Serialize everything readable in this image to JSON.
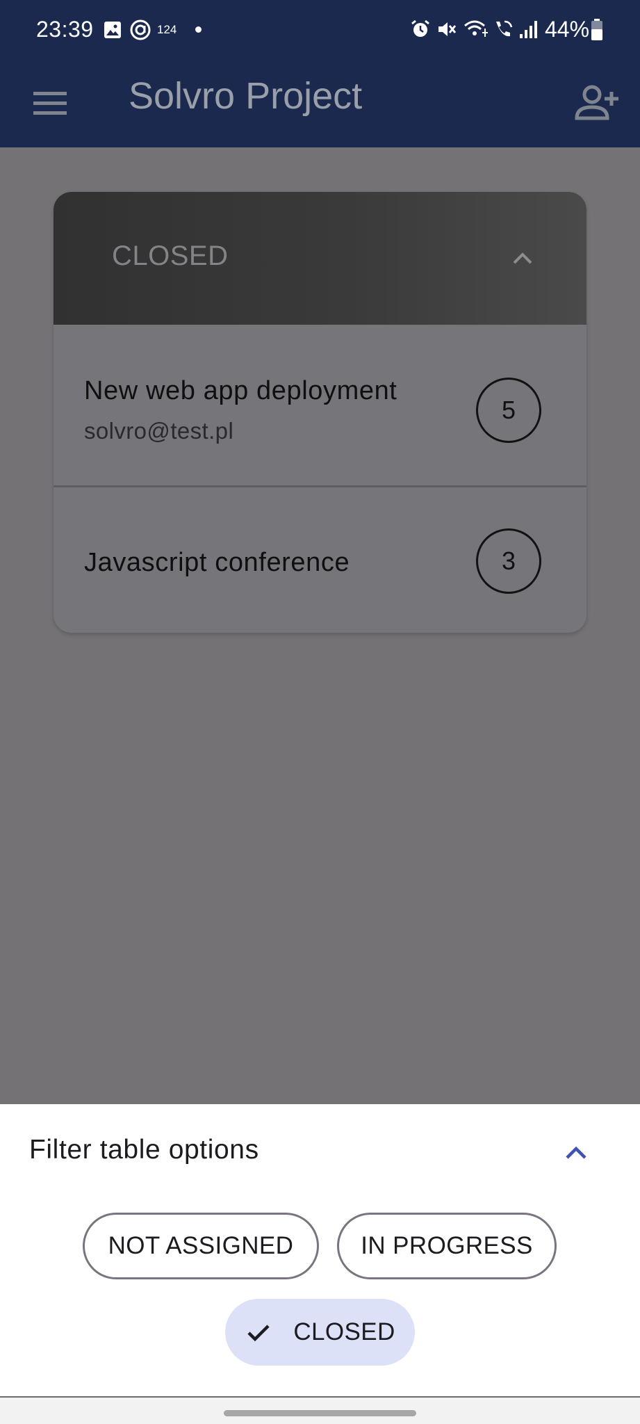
{
  "status_bar": {
    "time": "23:39",
    "notification_count": "124",
    "battery": "44%",
    "icons": [
      "gallery-icon",
      "at-sign-icon",
      "dot-icon",
      "alarm-icon",
      "mute-icon",
      "wifi-calling-icon",
      "call-icon",
      "signal-icon",
      "battery-icon"
    ]
  },
  "app_bar": {
    "title": "Solvro Project",
    "menu_icon": "menu-icon",
    "action_icon": "add-person-icon",
    "background_color": "#1b294f"
  },
  "card": {
    "header": {
      "title": "CLOSED",
      "icon": "chevron-up-icon"
    },
    "items": [
      {
        "title": "New web app deployment",
        "subtitle": "solvro@test.pl",
        "count": "5"
      },
      {
        "title": "Javascript conference",
        "subtitle": "",
        "count": "3"
      }
    ]
  },
  "filter_sheet": {
    "title": "Filter table options",
    "collapse_icon": "chevron-up-icon",
    "accent_color": "#3f51b5",
    "chips": [
      {
        "label": "NOT ASSIGNED",
        "selected": false
      },
      {
        "label": "IN PROGRESS",
        "selected": false
      },
      {
        "label": "CLOSED",
        "selected": true,
        "icon": "check-icon"
      }
    ],
    "selected_chip_color": "#dde1f8"
  }
}
